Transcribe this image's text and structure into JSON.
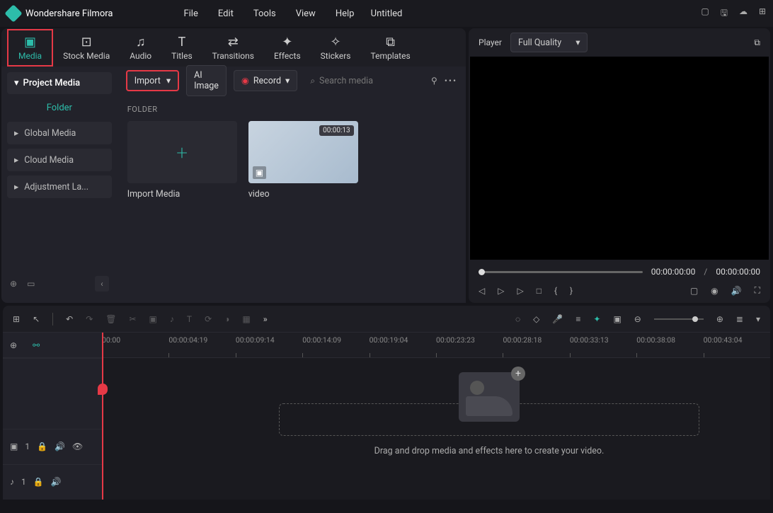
{
  "app": {
    "name": "Wondershare Filmora",
    "title": "Untitled"
  },
  "menu": [
    "File",
    "Edit",
    "Tools",
    "View",
    "Help"
  ],
  "tabs": [
    {
      "label": "Media",
      "active": true
    },
    {
      "label": "Stock Media"
    },
    {
      "label": "Audio"
    },
    {
      "label": "Titles"
    },
    {
      "label": "Transitions"
    },
    {
      "label": "Effects"
    },
    {
      "label": "Stickers"
    },
    {
      "label": "Templates"
    }
  ],
  "sidebar": {
    "project": "Project Media",
    "folder_label": "Folder",
    "items": [
      "Global Media",
      "Cloud Media",
      "Adjustment La..."
    ]
  },
  "toolbar": {
    "import": "Import",
    "ai_image": "AI Image",
    "record": "Record",
    "search_placeholder": "Search media"
  },
  "folder": {
    "header": "FOLDER",
    "import_label": "Import Media",
    "video_label": "video",
    "video_duration": "00:00:13"
  },
  "preview": {
    "label": "Player",
    "quality": "Full Quality",
    "time_current": "00:00:00:00",
    "time_total": "00:00:00:00"
  },
  "timeline": {
    "ticks": [
      "00:00",
      "00:00:04:19",
      "00:00:09:14",
      "00:00:14:09",
      "00:00:19:04",
      "00:00:23:23",
      "00:00:28:18",
      "00:00:33:13",
      "00:00:38:08",
      "00:00:43:04"
    ],
    "video_track": "1",
    "audio_track": "1",
    "drop_text": "Drag and drop media and effects here to create your video."
  }
}
